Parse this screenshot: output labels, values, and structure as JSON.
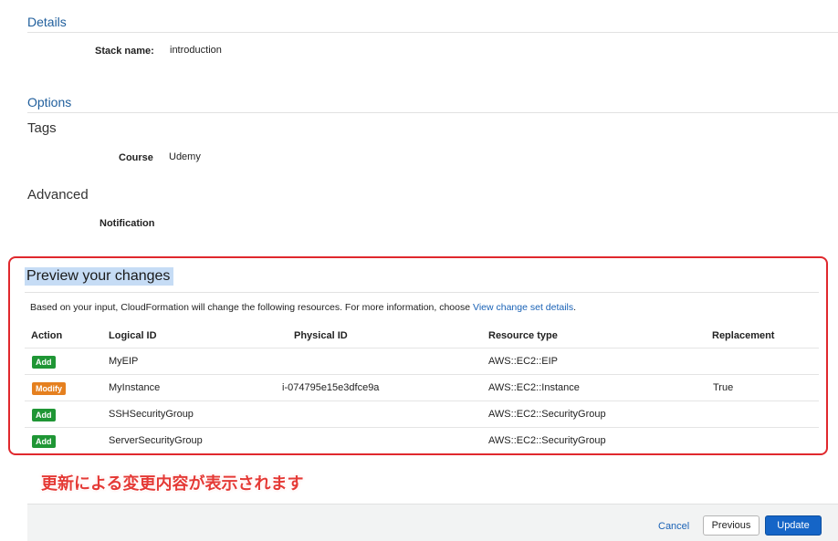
{
  "details": {
    "title": "Details",
    "stack_name_label": "Stack name:",
    "stack_name_value": "introduction"
  },
  "options": {
    "title": "Options",
    "tags_heading": "Tags",
    "tag_key": "Course",
    "tag_value": "Udemy",
    "advanced_heading": "Advanced",
    "notification_label": "Notification"
  },
  "preview": {
    "title": "Preview your changes",
    "description": "Based on your input, CloudFormation will change the following resources. For more information, choose ",
    "link_text": "View change set details",
    "link_suffix": ".",
    "columns": {
      "action": "Action",
      "logical_id": "Logical ID",
      "physical_id": "Physical ID",
      "resource_type": "Resource type",
      "replacement": "Replacement"
    },
    "rows": [
      {
        "action": "Add",
        "logical_id": "MyEIP",
        "physical_id": "",
        "resource_type": "AWS::EC2::EIP",
        "replacement": ""
      },
      {
        "action": "Modify",
        "logical_id": "MyInstance",
        "physical_id": "i-074795e15e3dfce9a",
        "resource_type": "AWS::EC2::Instance",
        "replacement": "True"
      },
      {
        "action": "Add",
        "logical_id": "SSHSecurityGroup",
        "physical_id": "",
        "resource_type": "AWS::EC2::SecurityGroup",
        "replacement": ""
      },
      {
        "action": "Add",
        "logical_id": "ServerSecurityGroup",
        "physical_id": "",
        "resource_type": "AWS::EC2::SecurityGroup",
        "replacement": ""
      }
    ]
  },
  "annotation": "更新による変更内容が表示されます",
  "footer": {
    "cancel": "Cancel",
    "previous": "Previous",
    "update": "Update"
  },
  "colors": {
    "add": "#1f9635",
    "modify": "#e5801f",
    "highlight_border": "#e0282d",
    "primary": "#1565c7"
  }
}
